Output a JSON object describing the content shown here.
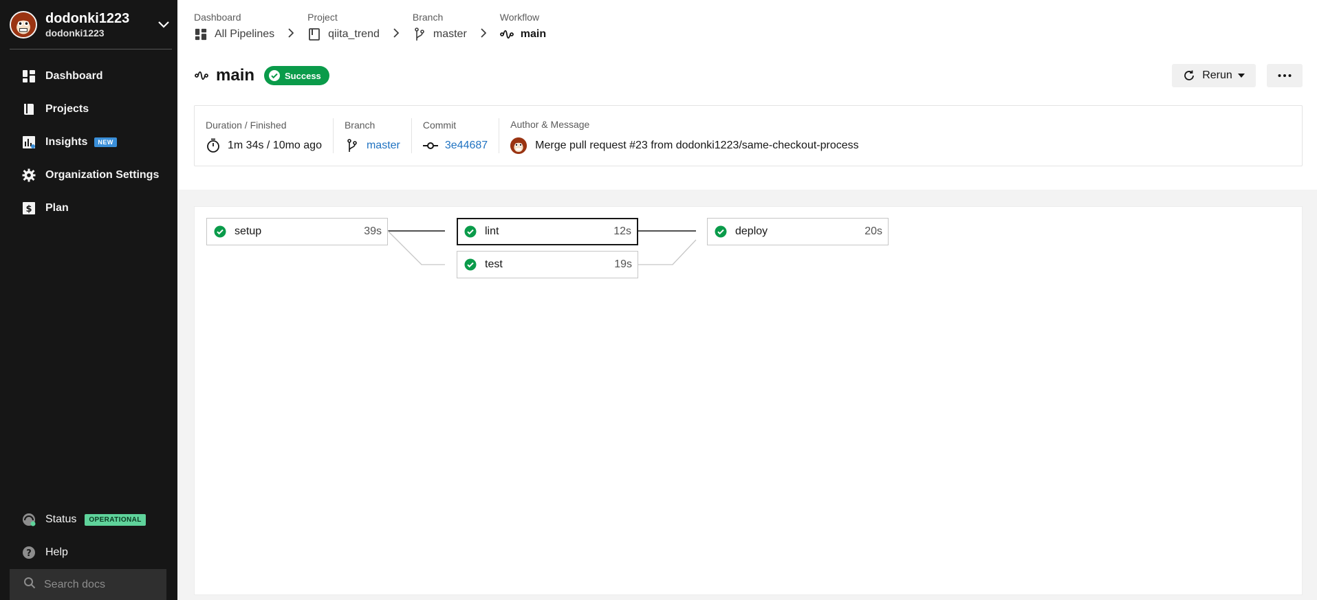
{
  "sidebar": {
    "org_name": "dodonki1223",
    "org_sub": "dodonki1223",
    "nav": [
      {
        "label": "Dashboard",
        "icon": "dashboard-icon"
      },
      {
        "label": "Projects",
        "icon": "projects-icon"
      },
      {
        "label": "Insights",
        "icon": "insights-icon",
        "badge": "NEW"
      },
      {
        "label": "Organization Settings",
        "icon": "gear-icon"
      },
      {
        "label": "Plan",
        "icon": "plan-dollar-icon"
      }
    ],
    "status": {
      "label": "Status",
      "badge": "OPERATIONAL"
    },
    "help": {
      "label": "Help"
    },
    "search_placeholder": "Search docs"
  },
  "breadcrumbs": [
    {
      "label": "Dashboard",
      "value": "All Pipelines",
      "icon": "dashboard-icon"
    },
    {
      "label": "Project",
      "value": "qiita_trend",
      "icon": "book-icon"
    },
    {
      "label": "Branch",
      "value": "master",
      "icon": "branch-icon"
    },
    {
      "label": "Workflow",
      "value": "main",
      "icon": "workflow-icon"
    }
  ],
  "title": {
    "name": "main",
    "status": "Success",
    "status_color": "#0a9b4a"
  },
  "actions": {
    "rerun_label": "Rerun"
  },
  "details": {
    "duration": {
      "label": "Duration / Finished",
      "value": "1m 34s / 10mo ago"
    },
    "branch": {
      "label": "Branch",
      "value": "master"
    },
    "commit": {
      "label": "Commit",
      "value": "3e44687"
    },
    "author": {
      "label": "Author & Message",
      "value": "Merge pull request #23 from dodonki1223/same-checkout-process"
    }
  },
  "jobs": [
    {
      "name": "setup",
      "time": "39s",
      "status": "success"
    },
    {
      "name": "lint",
      "time": "12s",
      "status": "success",
      "selected": true
    },
    {
      "name": "test",
      "time": "19s",
      "status": "success"
    },
    {
      "name": "deploy",
      "time": "20s",
      "status": "success"
    }
  ],
  "colors": {
    "success": "#0a9b4a",
    "link": "#1f72c1",
    "sidebar_bg": "#161616"
  }
}
